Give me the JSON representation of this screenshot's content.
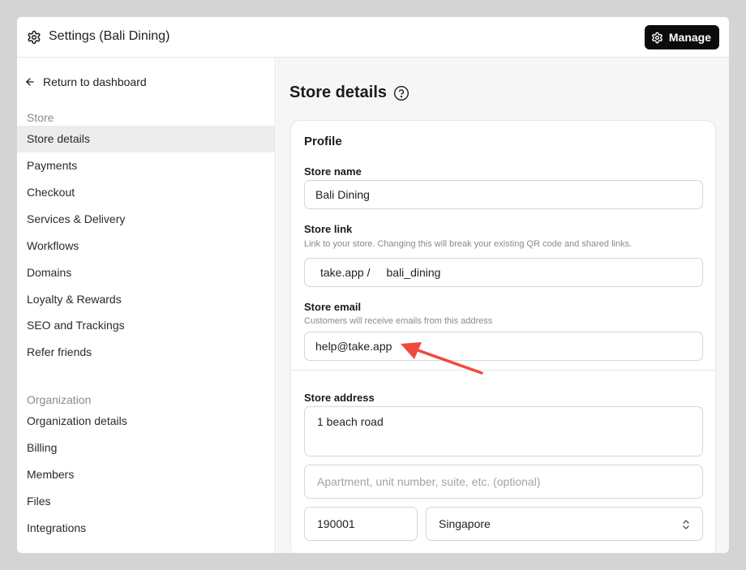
{
  "header": {
    "title": "Settings (Bali Dining)",
    "manage_label": "Manage"
  },
  "sidebar": {
    "back_label": "Return to dashboard",
    "store_section_label": "Store",
    "store_items": [
      {
        "label": "Store details",
        "active": true
      },
      {
        "label": "Payments"
      },
      {
        "label": "Checkout"
      },
      {
        "label": "Services & Delivery"
      },
      {
        "label": "Workflows"
      },
      {
        "label": "Domains"
      },
      {
        "label": "Loyalty & Rewards"
      },
      {
        "label": "SEO and Trackings"
      },
      {
        "label": "Refer friends"
      }
    ],
    "org_section_label": "Organization",
    "org_items": [
      {
        "label": "Organization details"
      },
      {
        "label": "Billing"
      },
      {
        "label": "Members"
      },
      {
        "label": "Files"
      },
      {
        "label": "Integrations"
      }
    ]
  },
  "main": {
    "page_title": "Store details",
    "profile": {
      "card_title": "Profile",
      "store_name": {
        "label": "Store name",
        "value": "Bali Dining"
      },
      "store_link": {
        "label": "Store link",
        "hint": "Link to your store. Changing this will break your existing QR code and shared links.",
        "prefix": "take.app /",
        "value": "bali_dining"
      },
      "store_email": {
        "label": "Store email",
        "hint": "Customers will receive emails from this address",
        "value": "help@take.app"
      },
      "store_address": {
        "label": "Store address",
        "line1": "1 beach road",
        "line2_placeholder": "Apartment, unit number, suite, etc. (optional)",
        "postal_code": "190001",
        "country": "Singapore"
      }
    }
  },
  "colors": {
    "accent_dark": "#0b0b0b",
    "annotation_arrow": "#ef4a3c",
    "active_nav_bg": "#ececec",
    "main_bg": "#f6f6f6"
  },
  "icons": {
    "header": "gear-icon",
    "manage": "gear-icon",
    "back": "arrow-left-icon",
    "help": "help-circle-icon",
    "select": "chevron-updown-icon"
  }
}
